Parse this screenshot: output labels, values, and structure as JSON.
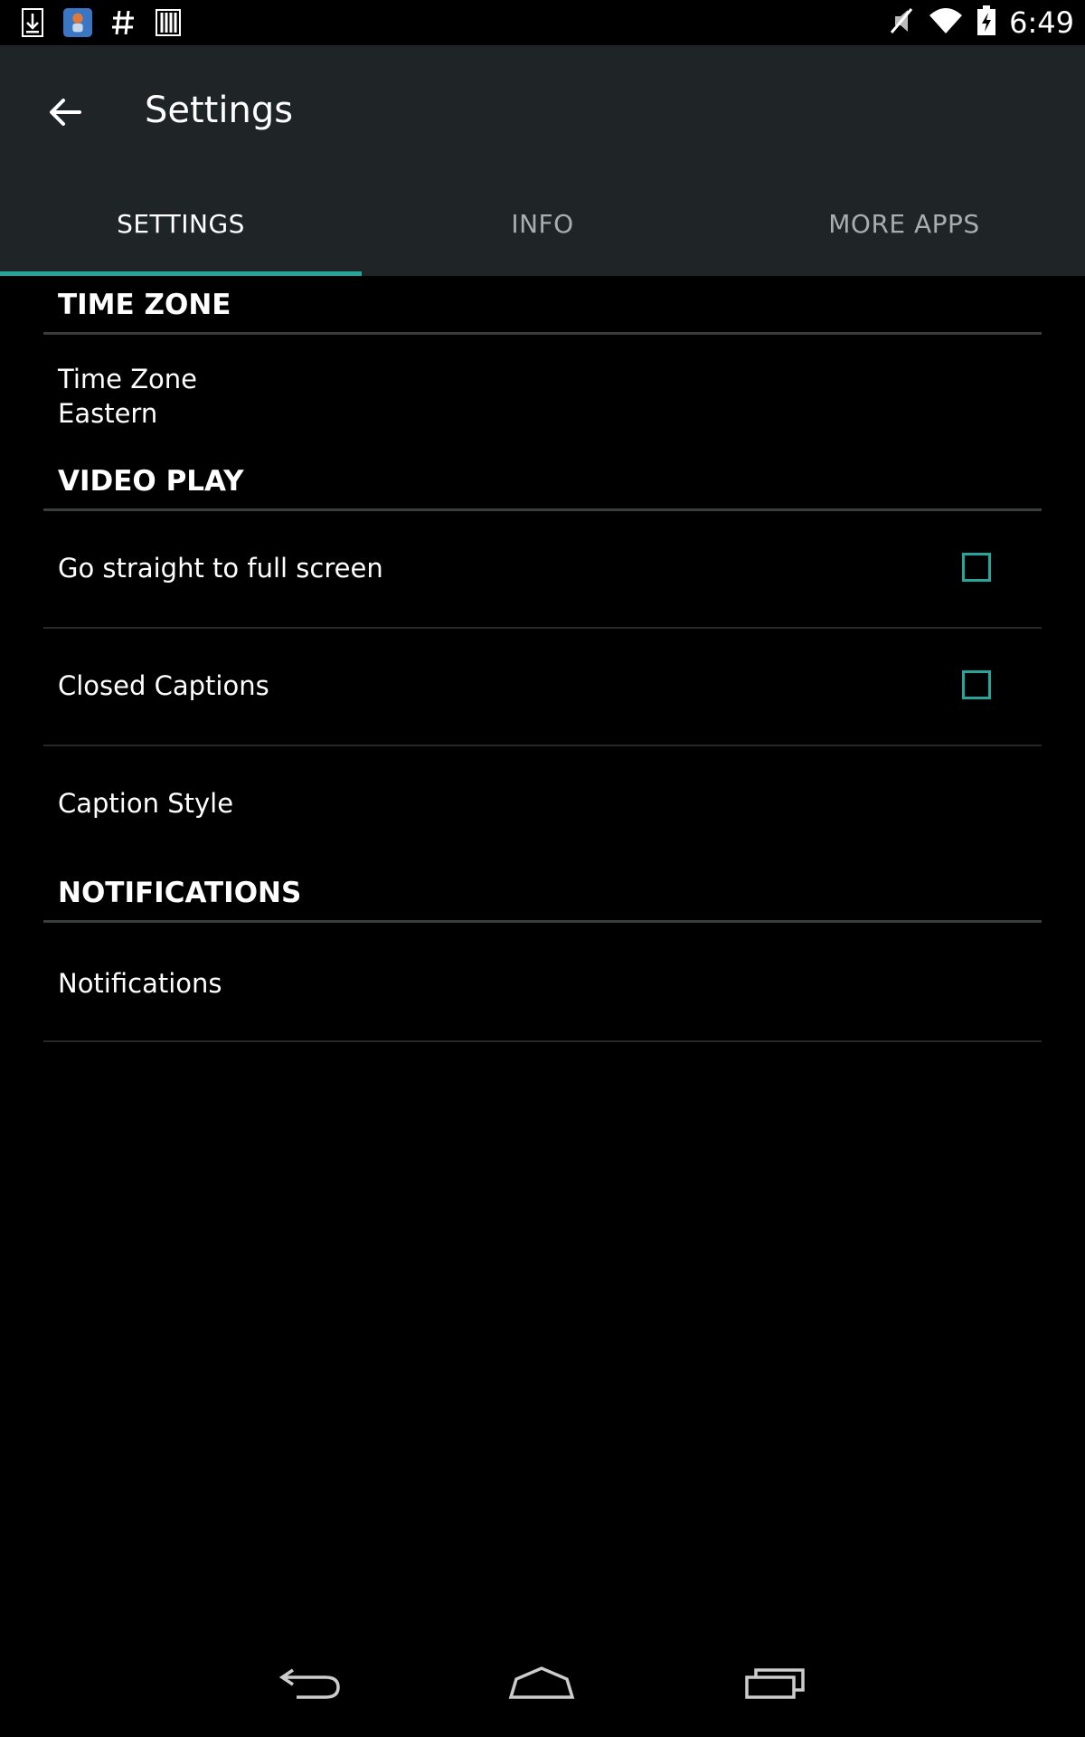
{
  "status_bar": {
    "time": "6:49",
    "left_icons": [
      "download-icon",
      "app-notification-icon",
      "hashtag-icon",
      "barcode-icon"
    ],
    "right_icons": [
      "mute-icon",
      "wifi-icon",
      "battery-charging-icon"
    ]
  },
  "app_bar": {
    "title": "Settings",
    "back_icon": "arrow-left-icon"
  },
  "tabs": [
    {
      "label": "SETTINGS",
      "active": true
    },
    {
      "label": "INFO",
      "active": false
    },
    {
      "label": "MORE APPS",
      "active": false
    }
  ],
  "sections": {
    "time_zone": {
      "header": "TIME ZONE",
      "item_title": "Time Zone",
      "item_value": "Eastern"
    },
    "video_play": {
      "header": "VIDEO PLAY",
      "full_screen_label": "Go straight to full screen",
      "full_screen_checked": false,
      "closed_captions_label": "Closed Captions",
      "closed_captions_checked": false,
      "caption_style_label": "Caption Style"
    },
    "notifications": {
      "header": "NOTIFICATIONS",
      "item_label": "Notifications"
    }
  },
  "colors": {
    "accent": "#26a69a",
    "app_bar": "#1f2526",
    "background": "#000000"
  },
  "nav_bar": {
    "icons": [
      "back-nav-icon",
      "home-nav-icon",
      "recents-nav-icon"
    ]
  }
}
